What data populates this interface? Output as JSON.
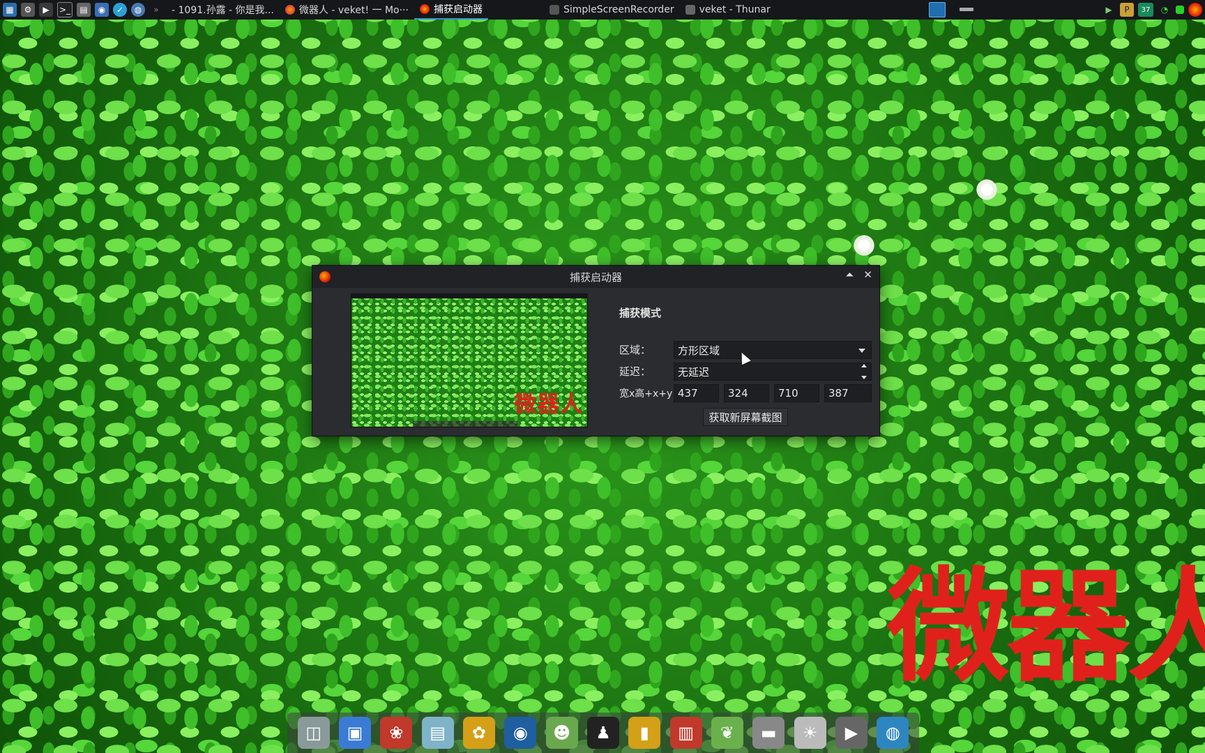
{
  "top_panel": {
    "tasks": [
      {
        "label": "- 1091.孙露 - 你是我..."
      },
      {
        "label": "微器人 - veket! 一 Mo···"
      },
      {
        "label": "捕获启动器"
      },
      {
        "label": "SimpleScreenRecorder"
      },
      {
        "label": "veket - Thunar"
      }
    ],
    "tray_battery": "37"
  },
  "window": {
    "title": "捕获启动器",
    "section_title": "捕获模式",
    "region_label": "区域：",
    "region_value": "方形区域",
    "delay_label": "延迟：",
    "delay_value": "无延迟",
    "geometry_label": "宽x高+x+y",
    "width": "437",
    "height": "324",
    "x": "710",
    "y": "387",
    "button_label": "获取新屏幕截图",
    "preview_watermark": "微器人"
  },
  "desktop": {
    "watermark": "微器人"
  },
  "colors": {
    "watermark": "#e0211b",
    "panel_bg": "#15171a",
    "window_bg": "#2a2c30",
    "accent": "#3a8fd9"
  },
  "icons": {
    "dock": [
      "hard-disk-icon",
      "monitor-icon",
      "squirrel-icon",
      "notepad-icon",
      "palette-icon",
      "media-player-icon",
      "chat-icon",
      "penguin-icon",
      "contacts-book-icon",
      "chart-icon",
      "leaf-icon",
      "drive-icon",
      "sun-icon",
      "play-icon",
      "globe-icon"
    ]
  }
}
